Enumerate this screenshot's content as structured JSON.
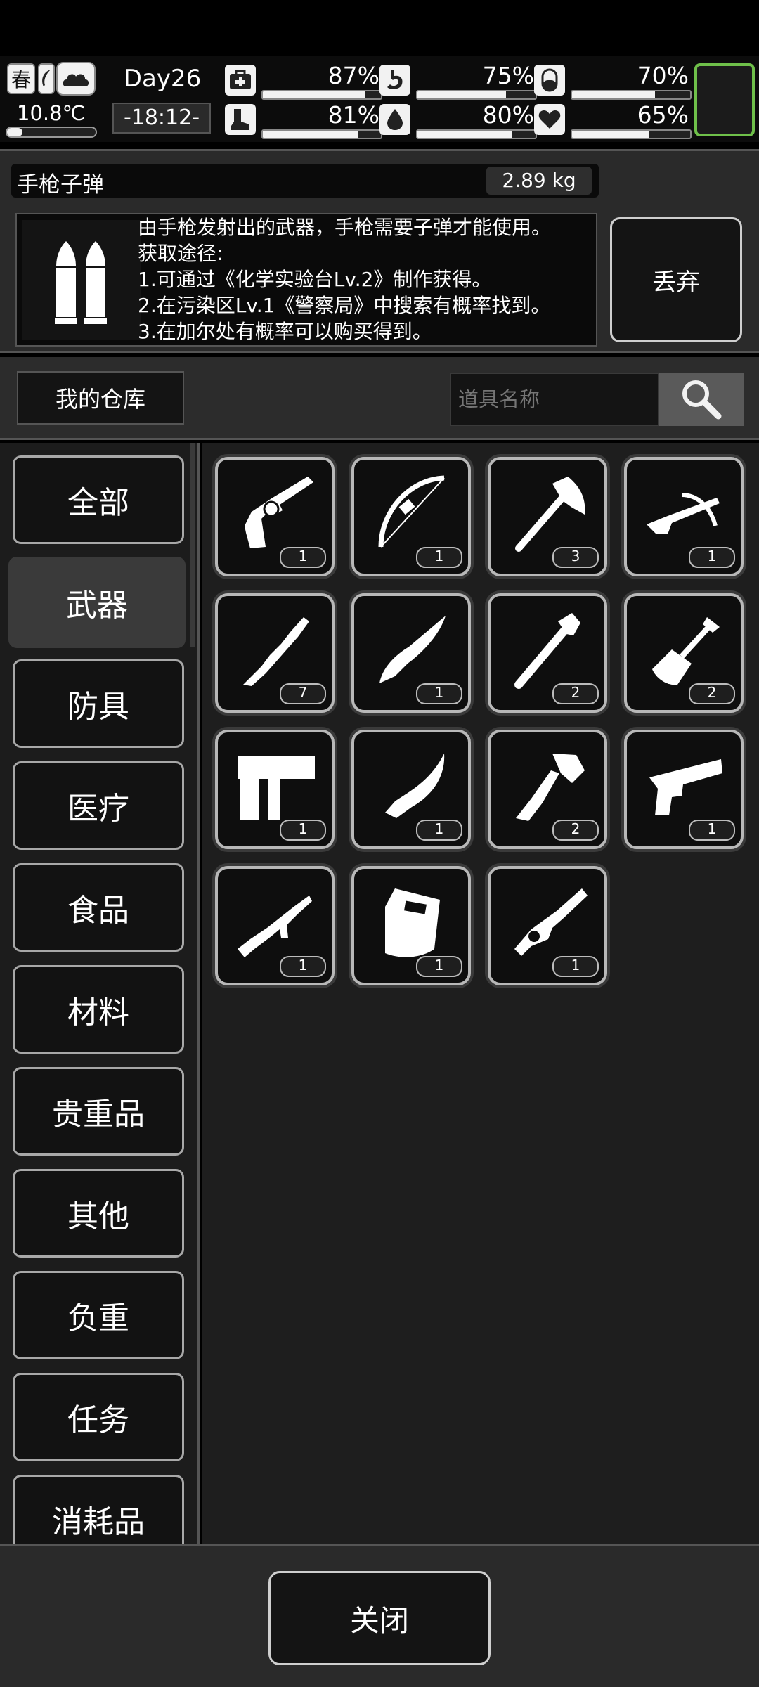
{
  "hud": {
    "season": "春",
    "temperature": "10.8℃",
    "day": "Day26",
    "time": "-18:12-",
    "stats": [
      {
        "icon": "medkit-icon",
        "value": "87%",
        "level": 0.87
      },
      {
        "icon": "stomach-icon",
        "value": "75%",
        "level": 0.75
      },
      {
        "icon": "pill-icon",
        "value": "70%",
        "level": 0.7
      },
      {
        "icon": "boot-icon",
        "value": "81%",
        "level": 0.81
      },
      {
        "icon": "water-drop-icon",
        "value": "80%",
        "level": 0.8
      },
      {
        "icon": "heart-icon",
        "value": "65%",
        "level": 0.65
      }
    ]
  },
  "item": {
    "name": "手枪子弹",
    "weight": "2.89 kg",
    "description": "由手枪发射出的武器，手枪需要子弹才能使用。\n获取途径:\n1.可通过《化学实验台Lv.2》制作获得。\n2.在污染区Lv.1《警察局》中搜索有概率找到。\n3.在加尔处有概率可以购买得到。",
    "discard_label": "丢弃"
  },
  "storage": {
    "title": "我的仓库",
    "search_placeholder": "道具名称"
  },
  "categories": [
    "全部",
    "武器",
    "防具",
    "医疗",
    "食品",
    "材料",
    "贵重品",
    "其他",
    "负重",
    "任务",
    "消耗品"
  ],
  "active_category": "武器",
  "items": [
    {
      "icon": "revolver-icon",
      "count": "1"
    },
    {
      "icon": "bow-icon",
      "count": "1"
    },
    {
      "icon": "axe-icon",
      "count": "3"
    },
    {
      "icon": "crossbow-icon",
      "count": "1"
    },
    {
      "icon": "wooden-club-icon",
      "count": "7"
    },
    {
      "icon": "knife-icon",
      "count": "1"
    },
    {
      "icon": "pipe-wrench-icon",
      "count": "2"
    },
    {
      "icon": "shovel-icon",
      "count": "2"
    },
    {
      "icon": "nail-gun-icon",
      "count": "1"
    },
    {
      "icon": "machete-icon",
      "count": "1"
    },
    {
      "icon": "tomahawk-icon",
      "count": "2"
    },
    {
      "icon": "pistol-icon",
      "count": "1"
    },
    {
      "icon": "submachine-gun-icon",
      "count": "1"
    },
    {
      "icon": "riot-shield-icon",
      "count": "1"
    },
    {
      "icon": "minigun-icon",
      "count": "1"
    }
  ],
  "footer": {
    "close_label": "关闭"
  }
}
